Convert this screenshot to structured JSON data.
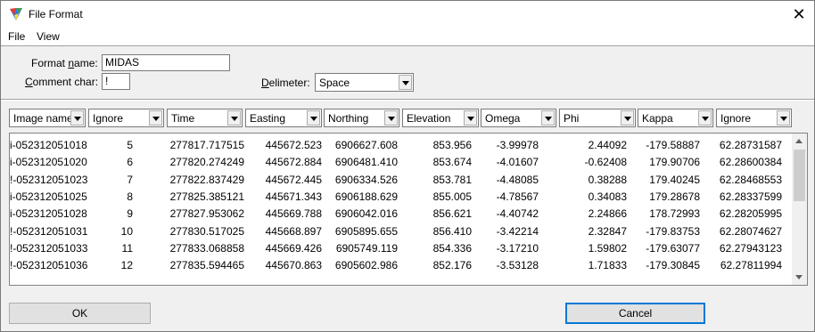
{
  "window": {
    "title": "File Format",
    "close_glyph": "✕"
  },
  "menu": {
    "items": [
      "File",
      "View"
    ]
  },
  "form": {
    "format_name_label_pre": "Format ",
    "format_name_label_u": "n",
    "format_name_label_post": "ame:",
    "format_name_value": "MIDAS",
    "comment_char_label_u": "C",
    "comment_char_label_post": "omment char:",
    "comment_char_value": "!",
    "delimeter_label_u": "D",
    "delimeter_label_post": "elimeter:",
    "delimeter_value": "Space"
  },
  "columns": [
    "Image name",
    "Ignore",
    "Time",
    "Easting",
    "Northing",
    "Elevation",
    "Omega",
    "Phi",
    "Kappa",
    "Ignore"
  ],
  "rows": [
    [
      "i-052312051018",
      "5",
      "277817.717515",
      "445672.523",
      "6906627.608",
      "853.956",
      "-3.99978",
      "2.44092",
      "-179.58887",
      "62.28731587"
    ],
    [
      "i-052312051020",
      "6",
      "277820.274249",
      "445672.884",
      "6906481.410",
      "853.674",
      "-4.01607",
      "-0.62408",
      "179.90706",
      "62.28600384"
    ],
    [
      "!-052312051023",
      "7",
      "277822.837429",
      "445672.445",
      "6906334.526",
      "853.781",
      "-4.48085",
      "0.38288",
      "179.40245",
      "62.28468553"
    ],
    [
      "i-052312051025",
      "8",
      "277825.385121",
      "445671.343",
      "6906188.629",
      "855.005",
      "-4.78567",
      "0.34083",
      "179.28678",
      "62.28337599"
    ],
    [
      "i-052312051028",
      "9",
      "277827.953062",
      "445669.788",
      "6906042.016",
      "856.621",
      "-4.40742",
      "2.24866",
      "178.72993",
      "62.28205995"
    ],
    [
      "!-052312051031",
      "10",
      "277830.517025",
      "445668.897",
      "6905895.655",
      "856.410",
      "-3.42214",
      "2.32847",
      "-179.83753",
      "62.28074627"
    ],
    [
      "!-052312051033",
      "11",
      "277833.068858",
      "445669.426",
      "6905749.119",
      "854.336",
      "-3.17210",
      "1.59802",
      "-179.63077",
      "62.27943123"
    ],
    [
      "!-052312051036",
      "12",
      "277835.594465",
      "445670.863",
      "6905602.986",
      "852.176",
      "-3.53128",
      "1.71833",
      "-179.30845",
      "62.27811994"
    ]
  ],
  "buttons": {
    "ok": "OK",
    "cancel": "Cancel"
  },
  "icons": {
    "app": "app-logo-icon",
    "close": "close-icon",
    "dropdown": "chevron-down-icon"
  }
}
